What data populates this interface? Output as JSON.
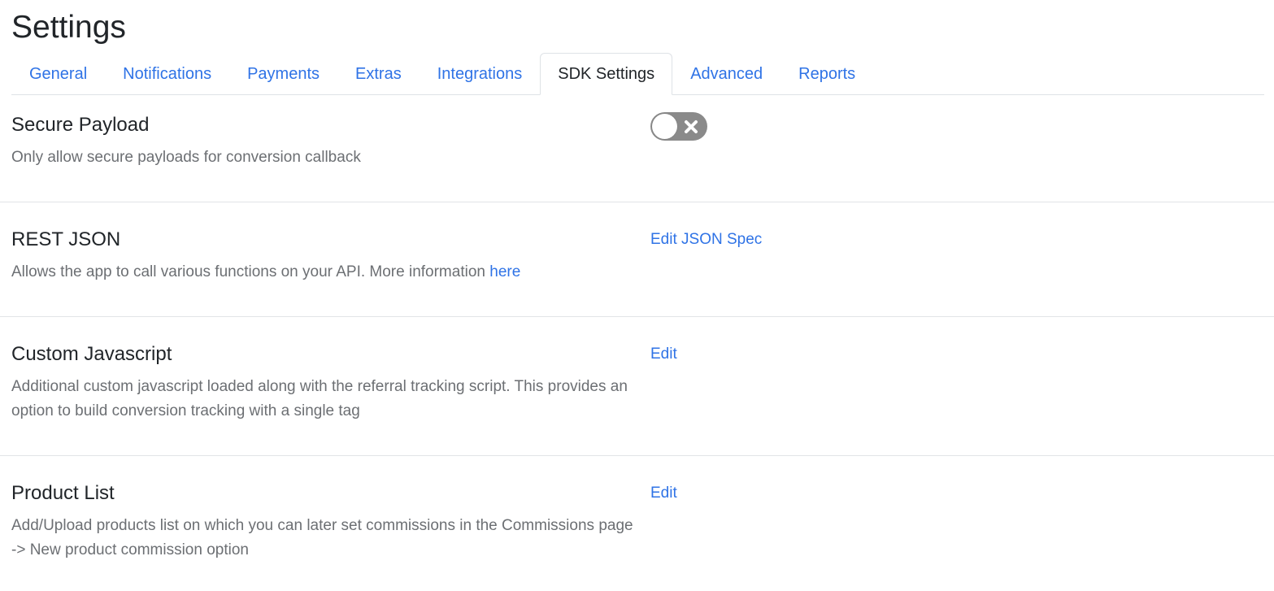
{
  "page": {
    "title": "Settings"
  },
  "tabs": [
    {
      "label": "General",
      "active": false
    },
    {
      "label": "Notifications",
      "active": false
    },
    {
      "label": "Payments",
      "active": false
    },
    {
      "label": "Extras",
      "active": false
    },
    {
      "label": "Integrations",
      "active": false
    },
    {
      "label": "SDK Settings",
      "active": true
    },
    {
      "label": "Advanced",
      "active": false
    },
    {
      "label": "Reports",
      "active": false
    }
  ],
  "sections": {
    "secure_payload": {
      "title": "Secure Payload",
      "description": "Only allow secure payloads for conversion callback",
      "toggle_state": "off",
      "toggle_icon": "close-icon"
    },
    "rest_json": {
      "title": "REST JSON",
      "description": "Allows the app to call various functions on your API. More information",
      "link_label": "here",
      "action_label": "Edit JSON Spec"
    },
    "custom_javascript": {
      "title": "Custom Javascript",
      "description": "Additional custom javascript loaded along with the referral tracking script. This provides an option to build conversion tracking with a single tag",
      "action_label": "Edit"
    },
    "product_list": {
      "title": "Product List",
      "description": "Add/Upload products list on which you can later set commissions in the Commissions page -> New product commission option",
      "action_label": "Edit"
    }
  },
  "colors": {
    "link": "#2f73e6",
    "toggle_off": "#8a8a8a",
    "muted_text": "#6c6f73"
  }
}
